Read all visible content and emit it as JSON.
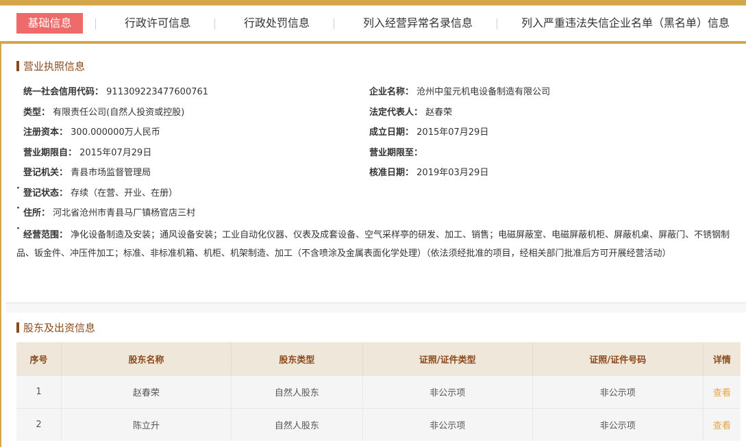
{
  "tabs": [
    {
      "label": "基础信息",
      "active": true
    },
    {
      "label": "行政许可信息",
      "active": false
    },
    {
      "label": "行政处罚信息",
      "active": false
    },
    {
      "label": "列入经营异常名录信息",
      "active": false
    },
    {
      "label": "列入严重违法失信企业名单（黑名单）信息",
      "active": false
    }
  ],
  "license": {
    "title": "营业执照信息",
    "credit_code_label": "统一社会信用代码：",
    "credit_code": "911309223477600761",
    "name_label": "企业名称：",
    "name": "沧州中玺元机电设备制造有限公司",
    "type_label": "类型：",
    "type": "有限责任公司(自然人投资或控股)",
    "legal_rep_label": "法定代表人：",
    "legal_rep": "赵春荣",
    "capital_label": "注册资本：",
    "capital": "300.000000万人民币",
    "established_label": "成立日期：",
    "established": "2015年07月29日",
    "term_from_label": "营业期限自：",
    "term_from": "2015年07月29日",
    "term_to_label": "营业期限至：",
    "term_to": "",
    "authority_label": "登记机关：",
    "authority": "青县市场监督管理局",
    "approval_label": "核准日期：",
    "approval": "2019年03月29日",
    "status_label": "登记状态：",
    "status": "存续（在营、开业、在册）",
    "address_label": "住所：",
    "address": "河北省沧州市青县马厂镇杨官店三村",
    "scope_label": "经营范围：",
    "scope": "净化设备制造及安装；通风设备安装；工业自动化仪器、仪表及成套设备、空气采样亭的研发、加工、销售；电磁屏蔽室、电磁屏蔽机柜、屏蔽机桌、屏蔽门、不锈钢制品、钣金件、冲压件加工；标准、非标准机箱、机柜、机架制造、加工（不含喷涂及金属表面化学处理）（依法须经批准的项目，经相关部门批准后方可开展经营活动）"
  },
  "shareholders": {
    "title": "股东及出资信息",
    "columns": [
      "序号",
      "股东名称",
      "股东类型",
      "证照/证件类型",
      "证照/证件号码",
      "详情"
    ],
    "rows": [
      {
        "no": "1",
        "name": "赵春荣",
        "type": "自然人股东",
        "doc_type": "非公示项",
        "doc_no": "非公示项",
        "detail": "查看"
      },
      {
        "no": "2",
        "name": "陈立升",
        "type": "自然人股东",
        "doc_type": "非公示项",
        "doc_no": "非公示项",
        "detail": "查看"
      }
    ]
  },
  "colors": {
    "accent": "#d6a64a",
    "active_tab": "#ef6b6b",
    "section_title": "#8b4a1c",
    "link": "#e8a43a"
  }
}
